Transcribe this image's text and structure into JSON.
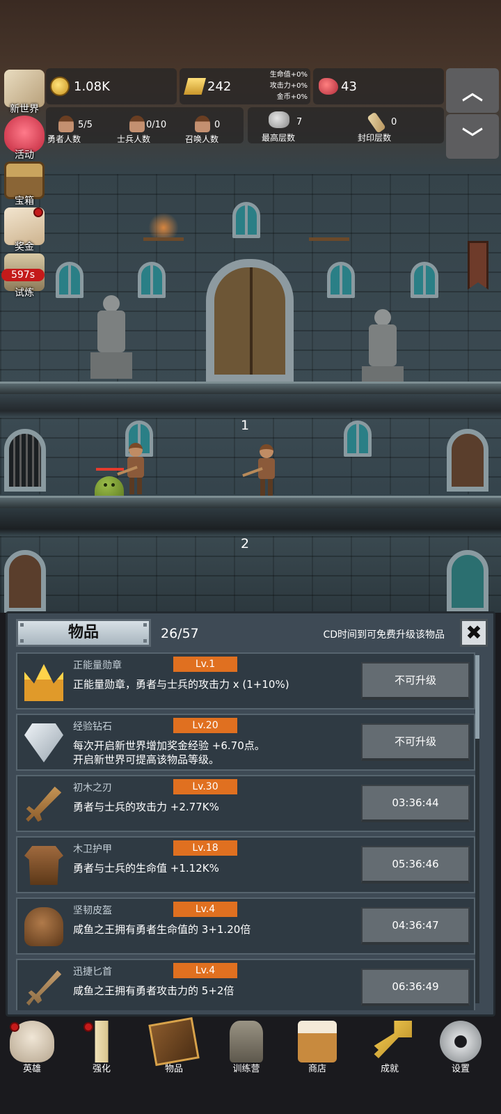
{
  "resources": {
    "gold": "1.08K",
    "ingots": "242",
    "bonus_lines": [
      "生命值+0%",
      "攻击力+0%",
      "金币+0%"
    ],
    "gems": "43"
  },
  "stats": {
    "heroes": {
      "value": "5/5",
      "label": "勇者人数"
    },
    "soldiers": {
      "value": "0/10",
      "label": "士兵人数"
    },
    "summons": {
      "value": "0",
      "label": "召唤人数"
    },
    "highest_floor": {
      "value": "7",
      "label": "最高层数"
    },
    "sealed_floor": {
      "value": "0",
      "label": "封印层数"
    }
  },
  "side_menu": [
    {
      "label": "新世界",
      "icon": "map-icon"
    },
    {
      "label": "活动",
      "icon": "heart-icon"
    },
    {
      "label": "宝箱",
      "icon": "chest-icon"
    },
    {
      "label": "奖金",
      "icon": "letter-icon"
    },
    {
      "label": "试炼",
      "icon": "trial-icon",
      "timer": "597s"
    }
  ],
  "scene": {
    "floor_1": "1",
    "floor_2": "2"
  },
  "items_panel": {
    "title": "物品",
    "count": "26/57",
    "cd_hint": "CD时间到可免费升级该物品",
    "close": "✖",
    "items": [
      {
        "name": "正能量勋章",
        "level": "Lv.1",
        "desc": "正能量勋章，勇者与士兵的攻击力 x (1+10%)",
        "button": "不可升级",
        "icon": "crown-icon"
      },
      {
        "name": "经验钻石",
        "level": "Lv.20",
        "desc": "每次开启新世界增加奖金经验 +6.70点。开启新世界可提高该物品等级。",
        "button": "不可升级",
        "icon": "diamond-icon"
      },
      {
        "name": "初木之刃",
        "level": "Lv.30",
        "desc": "勇者与士兵的攻击力 +2.77K%",
        "button": "03:36:44",
        "icon": "wooden-sword-icon"
      },
      {
        "name": "木卫护甲",
        "level": "Lv.18",
        "desc": "勇者与士兵的生命值 +1.12K%",
        "button": "05:36:46",
        "icon": "armor-icon"
      },
      {
        "name": "坚韧皮盔",
        "level": "Lv.4",
        "desc": "咸鱼之王拥有勇者生命值的 3+1.20倍",
        "button": "04:36:47",
        "icon": "helmet-icon"
      },
      {
        "name": "迅捷匕首",
        "level": "Lv.4",
        "desc": "咸鱼之王拥有勇者攻击力的 5+2倍",
        "button": "06:36:49",
        "icon": "dagger-icon"
      }
    ]
  },
  "bottom_nav": [
    {
      "label": "英雄",
      "icon": "skull-icon",
      "dot": true
    },
    {
      "label": "强化",
      "icon": "candle-icon",
      "dot": true
    },
    {
      "label": "物品",
      "icon": "book-icon",
      "dot": false
    },
    {
      "label": "训练营",
      "icon": "lantern-icon",
      "dot": false
    },
    {
      "label": "商店",
      "icon": "beer-mug-icon",
      "dot": false
    },
    {
      "label": "成就",
      "icon": "key-icon",
      "dot": false
    },
    {
      "label": "设置",
      "icon": "gear-icon",
      "dot": false
    }
  ]
}
